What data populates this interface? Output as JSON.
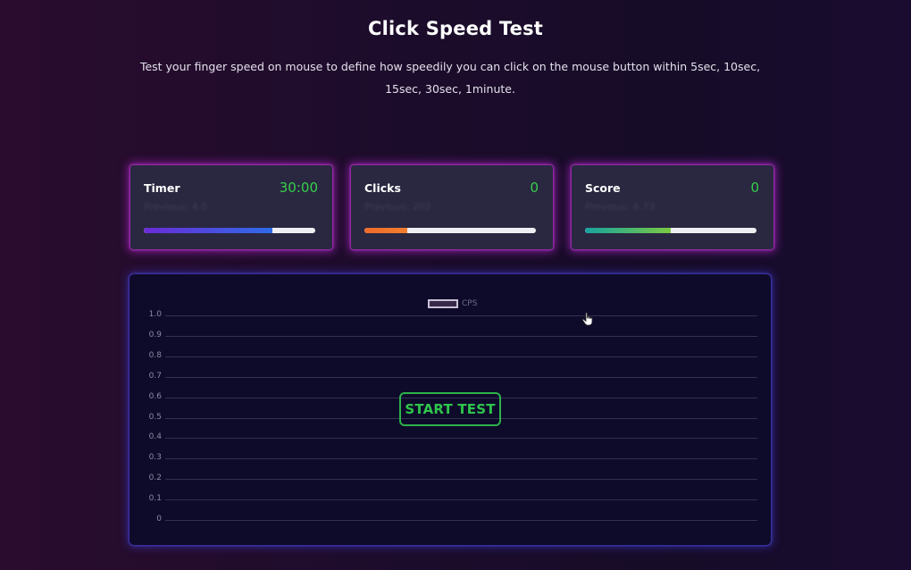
{
  "page": {
    "title": "Click Speed Test",
    "subtitle": "Test your finger speed on mouse to define how speedily you can click on the mouse button within 5sec, 10sec, 15sec, 30sec, 1minute."
  },
  "stats": [
    {
      "label": "Timer",
      "value": "30:00",
      "best": "Previous: 4.0",
      "progress": 0.75,
      "gradient": [
        "#6a2bd8",
        "#2f6be8"
      ],
      "icon": "none"
    },
    {
      "label": "Clicks",
      "value": "0",
      "best": "Previous: 202",
      "progress": 0.25,
      "gradient": [
        "#f06a2a",
        "#f07f2f"
      ],
      "icon": "none"
    },
    {
      "label": "Score",
      "value": "0",
      "best": "Previous: 6.73",
      "progress": 0.5,
      "gradient": [
        "#17a3a0",
        "#7ac943"
      ],
      "icon": "none"
    }
  ],
  "chart": {
    "start_button": "START TEST",
    "cursor_icon": "hand-pointer-icon"
  },
  "chart_data": {
    "type": "line",
    "legend": [
      "CPS"
    ],
    "series": [
      {
        "name": "CPS",
        "values": []
      }
    ],
    "y_ticks": [
      "1.0",
      "0.9",
      "0.8",
      "0.7",
      "0.6",
      "0.5",
      "0.4",
      "0.3",
      "0.2",
      "0.1",
      "0"
    ],
    "ylim": [
      0,
      1
    ],
    "grid": true,
    "legend_position": "top"
  },
  "colors": {
    "accent_green": "#2ec54b",
    "card_glow": "#cd28e6",
    "chart_glow": "#3c37c8"
  }
}
